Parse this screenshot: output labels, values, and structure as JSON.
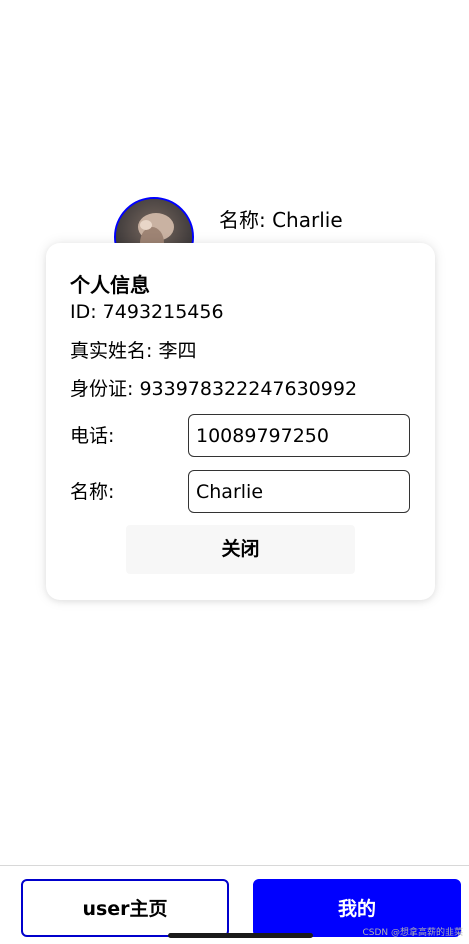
{
  "profile": {
    "name_text": "名称: Charlie"
  },
  "modal": {
    "title": "个人信息",
    "id_line": "ID: 7493215456",
    "real_name_line": "真实姓名: 李四",
    "id_card_line": "身份证: 933978322247630992",
    "phone": {
      "label": "电话:",
      "value": "10089797250"
    },
    "nickname": {
      "label": "名称:",
      "value": "Charlie"
    },
    "close_label": "关闭"
  },
  "bottom_nav": {
    "home_label": "user主页",
    "mine_label": "我的"
  },
  "watermark": "CSDN @想拿高薪的韭菜",
  "colors": {
    "accent": "#0000ff",
    "close_button_bg": "#f7f7f7"
  }
}
